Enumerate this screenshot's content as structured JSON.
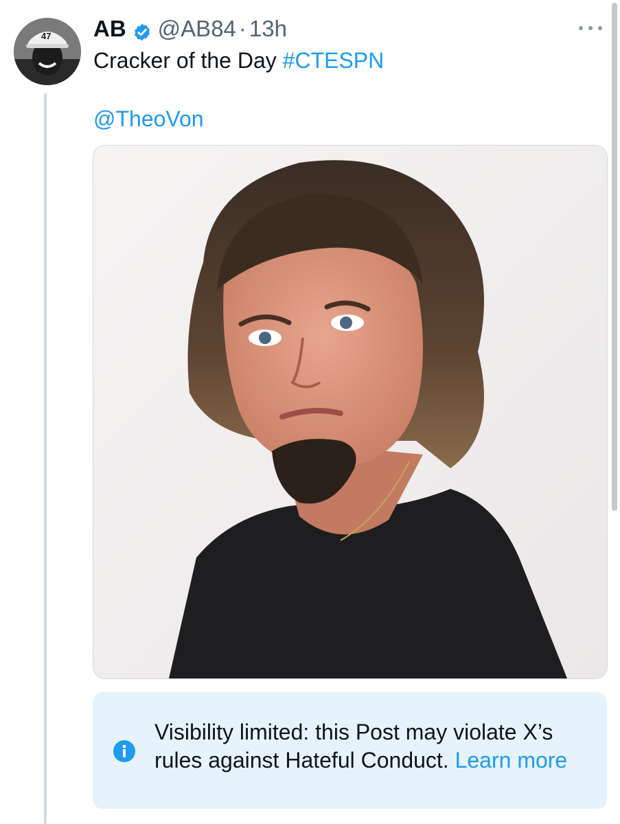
{
  "post": {
    "author_name": "AB",
    "handle": "@AB84",
    "separator": "·",
    "timestamp": "13h",
    "text": "Cracker of the Day ",
    "hashtag": "#CTESPN",
    "mention": "@TheoVon"
  },
  "avatar": {
    "cap_text": "47"
  },
  "notice": {
    "text": "Visibility limited: this Post may violate X’s rules against Hateful Conduct. ",
    "link_label": "Learn more"
  },
  "icons": {
    "verified": "verified-badge-icon",
    "more": "more-options-icon",
    "info": "info-icon"
  },
  "colors": {
    "accent": "#1d9bf0",
    "text": "#0f1419",
    "secondary": "#536471",
    "notice_bg": "#e7f3fc"
  }
}
